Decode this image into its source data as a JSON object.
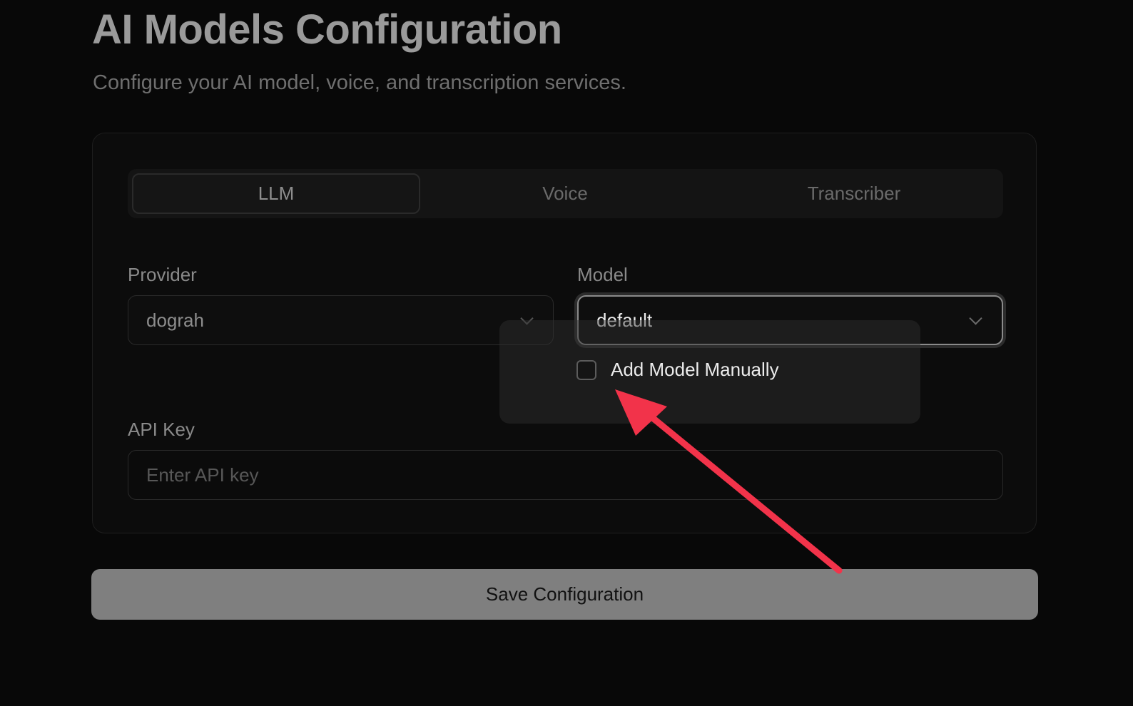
{
  "header": {
    "title": "AI Models Configuration",
    "subtitle": "Configure your AI model, voice, and transcription services."
  },
  "tabs": [
    {
      "label": "LLM",
      "active": true
    },
    {
      "label": "Voice",
      "active": false
    },
    {
      "label": "Transcriber",
      "active": false
    }
  ],
  "form": {
    "provider": {
      "label": "Provider",
      "value": "dograh"
    },
    "model": {
      "label": "Model",
      "value": "default"
    },
    "add_model_manually": {
      "label": "Add Model Manually",
      "checked": false
    },
    "api_key": {
      "label": "API Key",
      "placeholder": "Enter API key",
      "value": ""
    }
  },
  "actions": {
    "save_label": "Save Configuration"
  },
  "colors": {
    "background": "#080808",
    "save_button": "#7f7f7f",
    "annotation_arrow": "#f2334a"
  },
  "icons": [
    "chevron-down-icon",
    "arrow-annotation"
  ]
}
